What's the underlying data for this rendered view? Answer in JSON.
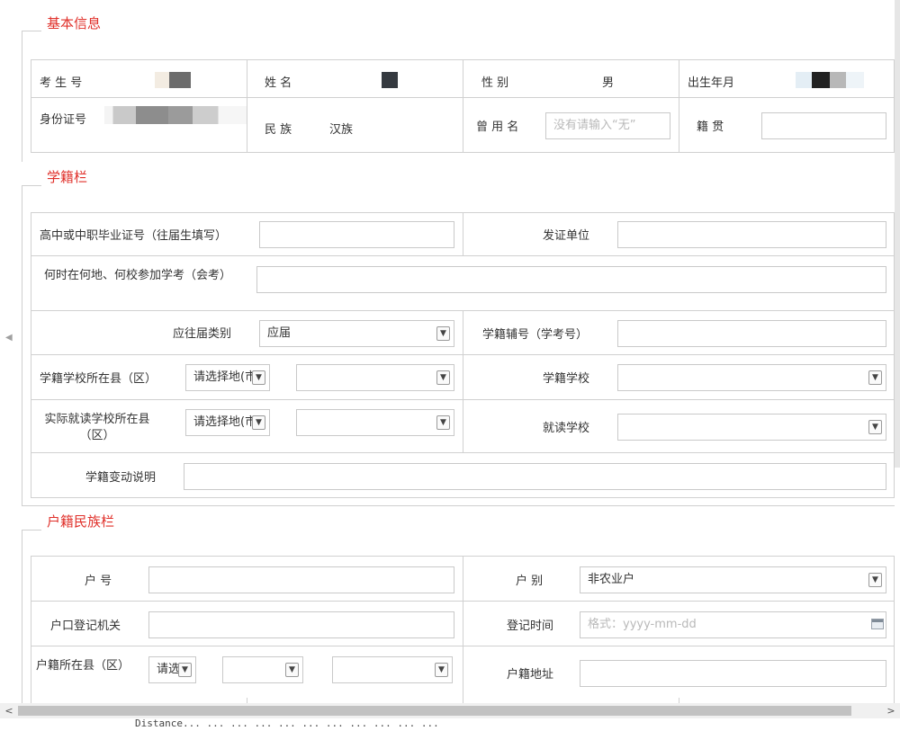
{
  "sections": {
    "basic": "基本信息",
    "school": "学籍栏",
    "household": "户籍民族栏"
  },
  "basic": {
    "exam_no_label": "考 生 号",
    "name_label": "姓   名",
    "gender_label": "性   别",
    "gender_value": "男",
    "birth_label": "出生年月",
    "id_label": "身份证号",
    "ethnic_label": "民   族",
    "ethnic_value": "汉族",
    "former_name_label": "曾 用 名",
    "former_name_placeholder": "没有请输入“无”",
    "native_label": "籍   贯"
  },
  "school": {
    "cert_no_label": "高中或中职毕业证号（往届生填写）",
    "issuer_label": "发证单位",
    "exam_when_label": "何时在何地、何校参加学考（会考）",
    "grad_type_label": "应往届类别",
    "grad_type_value": "应届",
    "aux_no_label": "学籍辅号（学考号）",
    "school_county_label": "学籍学校所在县（区）",
    "select_region": "请选择地(市",
    "school_label": "学籍学校",
    "actual_county_label": "实际就读学校所在县（区）",
    "actual_school_label": "就读学校",
    "change_label": "学籍变动说明"
  },
  "household": {
    "hukou_no_label": "户   号",
    "hukou_type_label": "户   别",
    "hukou_type_value": "非农业户",
    "authority_label": "户口登记机关",
    "reg_time_label": "登记时间",
    "reg_time_placeholder": "格式：yyyy-mm-dd",
    "county_label": "户籍所在县（区）",
    "county_select": "请选",
    "address_label": "户籍地址"
  },
  "bottom_text": "Distance... ... ... ... ... ... ... ... ... ... ...",
  "colors": {
    "legend": "#e0302a",
    "border": "#d0d0d0"
  }
}
